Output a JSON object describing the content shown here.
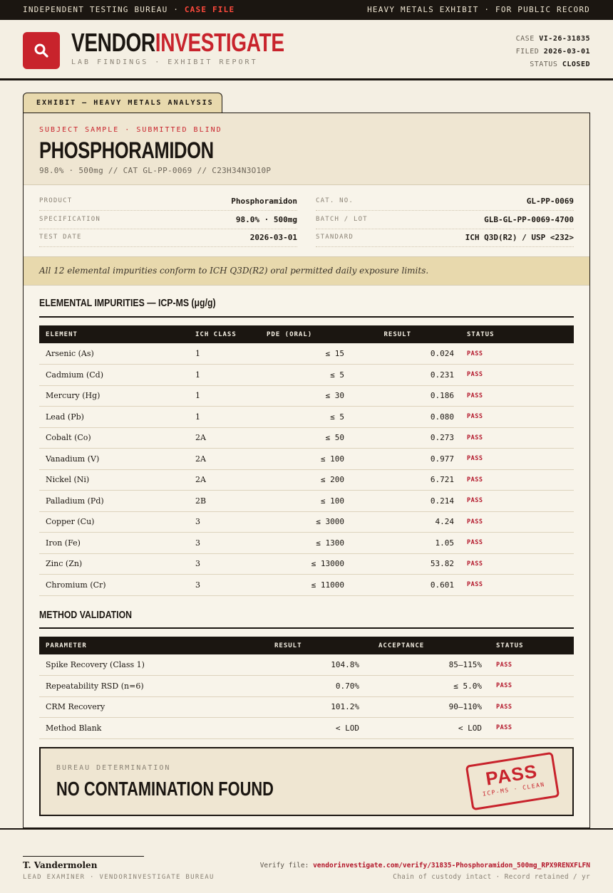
{
  "topbar": {
    "left_prefix": "INDEPENDENT TESTING BUREAU · ",
    "left_highlight": "CASE FILE",
    "right": "HEAVY METALS EXHIBIT · FOR PUBLIC RECORD"
  },
  "header": {
    "brand_part1": "VENDOR",
    "brand_part2": "INVESTIGATE",
    "subtitle": "LAB FINDINGS · EXHIBIT REPORT",
    "logo_icon": "magnifier-icon",
    "case_label": "CASE",
    "case_value": "VI-26-31835",
    "filed_label": "FILED",
    "filed_value": "2026-03-01",
    "status_label": "STATUS",
    "status_value": "CLOSED"
  },
  "exhibit": {
    "tab_label": "EXHIBIT — HEAVY METALS ANALYSIS",
    "kicker": "SUBJECT SAMPLE · SUBMITTED BLIND",
    "title": "PHOSPHORAMIDON",
    "meta": "98.0% · 500mg  //  CAT GL-PP-0069  //  C23H34N3O10P"
  },
  "facts": {
    "product_label": "PRODUCT",
    "product_value": "Phosphoramidon",
    "spec_label": "SPECIFICATION",
    "spec_value": "98.0% · 500mg",
    "date_label": "TEST DATE",
    "date_value": "2026-03-01",
    "cat_label": "CAT. NO.",
    "cat_value": "GL-PP-0069",
    "batch_label": "BATCH / LOT",
    "batch_value": "GLB-GL-PP-0069-4700",
    "standard_label": "STANDARD",
    "standard_value": "ICH Q3D(R2) / USP <232>"
  },
  "summary": "All 12 elemental impurities conform to ICH Q3D(R2) oral permitted daily exposure limits.",
  "impurities": {
    "title": "ELEMENTAL IMPURITIES — ICP-MS (μg/g)",
    "headers": [
      "ELEMENT",
      "ICH CLASS",
      "PDE (ORAL)",
      "RESULT",
      "STATUS"
    ],
    "rows": [
      {
        "element": "Arsenic (As)",
        "class": "1",
        "pde": "≤ 15",
        "result": "0.024",
        "status": "PASS"
      },
      {
        "element": "Cadmium (Cd)",
        "class": "1",
        "pde": "≤ 5",
        "result": "0.231",
        "status": "PASS"
      },
      {
        "element": "Mercury (Hg)",
        "class": "1",
        "pde": "≤ 30",
        "result": "0.186",
        "status": "PASS"
      },
      {
        "element": "Lead (Pb)",
        "class": "1",
        "pde": "≤ 5",
        "result": "0.080",
        "status": "PASS"
      },
      {
        "element": "Cobalt (Co)",
        "class": "2A",
        "pde": "≤ 50",
        "result": "0.273",
        "status": "PASS"
      },
      {
        "element": "Vanadium (V)",
        "class": "2A",
        "pde": "≤ 100",
        "result": "0.977",
        "status": "PASS"
      },
      {
        "element": "Nickel (Ni)",
        "class": "2A",
        "pde": "≤ 200",
        "result": "6.721",
        "status": "PASS"
      },
      {
        "element": "Palladium (Pd)",
        "class": "2B",
        "pde": "≤ 100",
        "result": "0.214",
        "status": "PASS"
      },
      {
        "element": "Copper (Cu)",
        "class": "3",
        "pde": "≤ 3000",
        "result": "4.24",
        "status": "PASS"
      },
      {
        "element": "Iron (Fe)",
        "class": "3",
        "pde": "≤ 1300",
        "result": "1.05",
        "status": "PASS"
      },
      {
        "element": "Zinc (Zn)",
        "class": "3",
        "pde": "≤ 13000",
        "result": "53.82",
        "status": "PASS"
      },
      {
        "element": "Chromium (Cr)",
        "class": "3",
        "pde": "≤ 11000",
        "result": "0.601",
        "status": "PASS"
      }
    ]
  },
  "validation": {
    "title": "METHOD VALIDATION",
    "headers": [
      "PARAMETER",
      "RESULT",
      "ACCEPTANCE",
      "STATUS"
    ],
    "rows": [
      {
        "parameter": "Spike Recovery (Class 1)",
        "result": "104.8%",
        "acceptance": "85–115%",
        "status": "PASS"
      },
      {
        "parameter": "Repeatability RSD (n=6)",
        "result": "0.70%",
        "acceptance": "≤ 5.0%",
        "status": "PASS"
      },
      {
        "parameter": "CRM Recovery",
        "result": "101.2%",
        "acceptance": "90–110%",
        "status": "PASS"
      },
      {
        "parameter": "Method Blank",
        "result": "< LOD",
        "acceptance": "< LOD",
        "status": "PASS"
      }
    ]
  },
  "determination": {
    "label": "BUREAU DETERMINATION",
    "value": "NO CONTAMINATION FOUND",
    "stamp_main": "PASS",
    "stamp_sub": "ICP-MS · CLEAN"
  },
  "footer": {
    "signer": "T. Vandermolen",
    "role": "LEAD EXAMINER · VENDORINVESTIGATE BUREAU",
    "verify_label": "Verify file: ",
    "verify_link": "vendorinvestigate.com/verify/31835-Phosphoramidon_500mg_RPX9RENXFLFN",
    "custody": "Chain of custody intact · Record retained / yr"
  },
  "colors": {
    "accent": "#c8232c",
    "ink": "#1b1611",
    "paper": "#f4efe3",
    "tan": "#e8d9ad"
  }
}
